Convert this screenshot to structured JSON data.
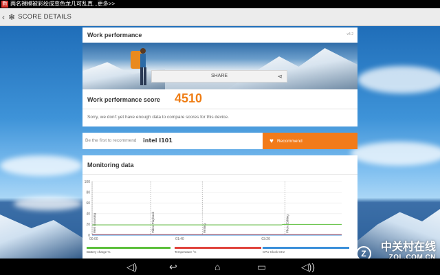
{
  "status_bar": {
    "notification_text": "两名裸模被彩绘成变色龙几可乱真...更多>>"
  },
  "action_bar": {
    "title": "SCORE DETAILS"
  },
  "work_card": {
    "title": "Work performance",
    "version": "v4.2",
    "share_label": "SHARE",
    "score_label": "Work performance score",
    "score_value": "4510",
    "no_data_msg": "Sorry, we don't yet have enough data to compare scores for this device."
  },
  "recommend": {
    "prompt": "Be the first to recommend",
    "device": "intel I101",
    "button_label": "Recommend"
  },
  "monitoring": {
    "title": "Monitoring data",
    "legend": [
      "Battery charge %",
      "Temperature °C",
      "CPU Clock GHz"
    ]
  },
  "chart_data": {
    "type": "line",
    "ylim": [
      0,
      100
    ],
    "y_ticks": [
      "100",
      "80",
      "60",
      "40",
      "20",
      "0"
    ],
    "x_tick_labels": [
      "00:00",
      "01:40",
      "03:20"
    ],
    "x_ticks": [
      0,
      100,
      200
    ],
    "xlim": [
      0,
      290
    ],
    "phases": [
      {
        "label": "Web Browsing",
        "x": 0
      },
      {
        "label": "Video Playback",
        "x": 68
      },
      {
        "label": "Writing",
        "x": 128
      },
      {
        "label": "Photo Editing",
        "x": 224
      }
    ],
    "series": [
      {
        "name": "Battery charge %",
        "color": "#5bbf3a",
        "x": [
          0,
          220,
          222,
          290
        ],
        "values": [
          19,
          19,
          20,
          20
        ]
      },
      {
        "name": "Temperature °C",
        "color": "#e0443c",
        "x": [
          0,
          290
        ],
        "values": [
          1,
          1
        ]
      },
      {
        "name": "CPU Clock GHz",
        "color": "#3a8fd9",
        "x": [
          0,
          290
        ],
        "values": [
          0,
          0
        ]
      }
    ]
  },
  "nav": {
    "icons": [
      "volume-down-icon",
      "back-icon",
      "home-icon",
      "volume-up-icon",
      "recents-icon"
    ]
  },
  "watermark": {
    "main": "中关村在线",
    "sub": "ZOL.COM.CN",
    "logo": "Z"
  },
  "colors": {
    "accent": "#ef7d14",
    "recommend_bg": "#f27b1a"
  }
}
